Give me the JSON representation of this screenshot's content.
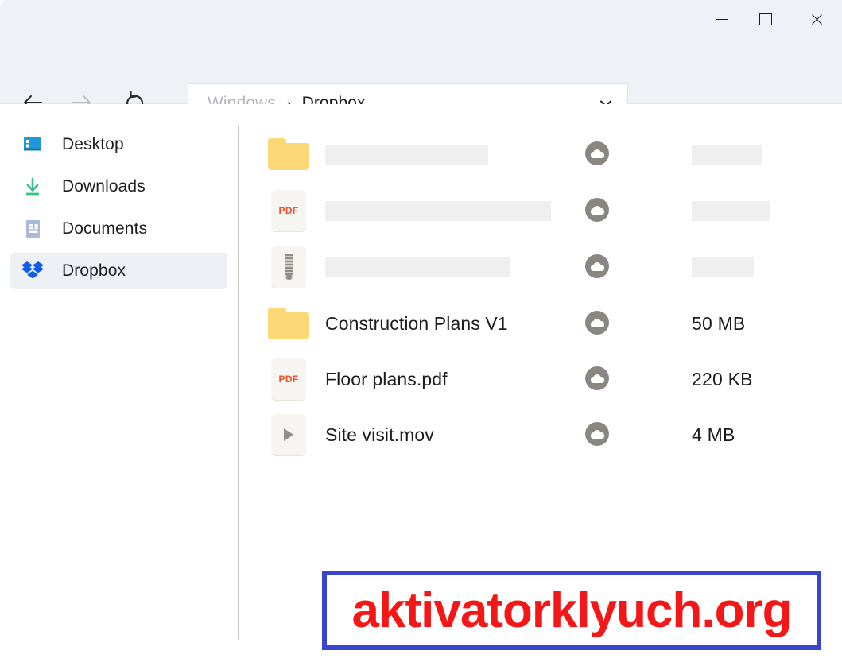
{
  "window": {
    "controls": {
      "minimize_label": "Minimize",
      "maximize_label": "Maximize",
      "close_label": "Close"
    }
  },
  "toolbar": {
    "back_label": "Back",
    "forward_label": "Forward",
    "refresh_label": "Refresh",
    "address": {
      "root": "Windows",
      "separator": "›",
      "current": "Dropbox",
      "dropdown_label": "History"
    }
  },
  "sidebar": {
    "items": [
      {
        "label": "Desktop",
        "icon": "desktop-icon",
        "selected": false
      },
      {
        "label": "Downloads",
        "icon": "download-icon",
        "selected": false
      },
      {
        "label": "Documents",
        "icon": "document-icon",
        "selected": false
      },
      {
        "label": "Dropbox",
        "icon": "dropbox-icon",
        "selected": true
      }
    ]
  },
  "file_list": {
    "rows": [
      {
        "loading": true,
        "icon": "folder-icon",
        "name": "",
        "size": "",
        "sync_status": "cloud-icon",
        "name_skeleton_width": 205,
        "size_skeleton_width": 88
      },
      {
        "loading": true,
        "icon": "pdf-file-icon",
        "name": "",
        "size": "",
        "sync_status": "cloud-icon",
        "name_skeleton_width": 284,
        "size_skeleton_width": 98
      },
      {
        "loading": true,
        "icon": "zip-file-icon",
        "name": "",
        "size": "",
        "sync_status": "cloud-icon",
        "name_skeleton_width": 232,
        "size_skeleton_width": 78
      },
      {
        "loading": false,
        "icon": "folder-icon",
        "name": "Construction Plans V1",
        "size": "50 MB",
        "sync_status": "cloud-icon"
      },
      {
        "loading": false,
        "icon": "pdf-file-icon",
        "name": "Floor plans.pdf",
        "size": "220 KB",
        "sync_status": "cloud-icon"
      },
      {
        "loading": false,
        "icon": "video-file-icon",
        "name": "Site visit.mov",
        "size": "4 MB",
        "sync_status": "cloud-icon"
      }
    ]
  },
  "watermark": {
    "text": "aktivatorklyuch.org",
    "text_color": "#f41718",
    "border_color": "#3a45cf"
  },
  "colors": {
    "chrome_bg": "#eef1f6",
    "folder_yellow": "#fcd877",
    "dropbox_blue": "#0f5deb",
    "download_green": "#35c486",
    "desktop_blue": "#2196d8",
    "cloud_gray": "#8a8780",
    "skeleton_gray": "#efefef",
    "selected_row": "#edf0f4"
  }
}
